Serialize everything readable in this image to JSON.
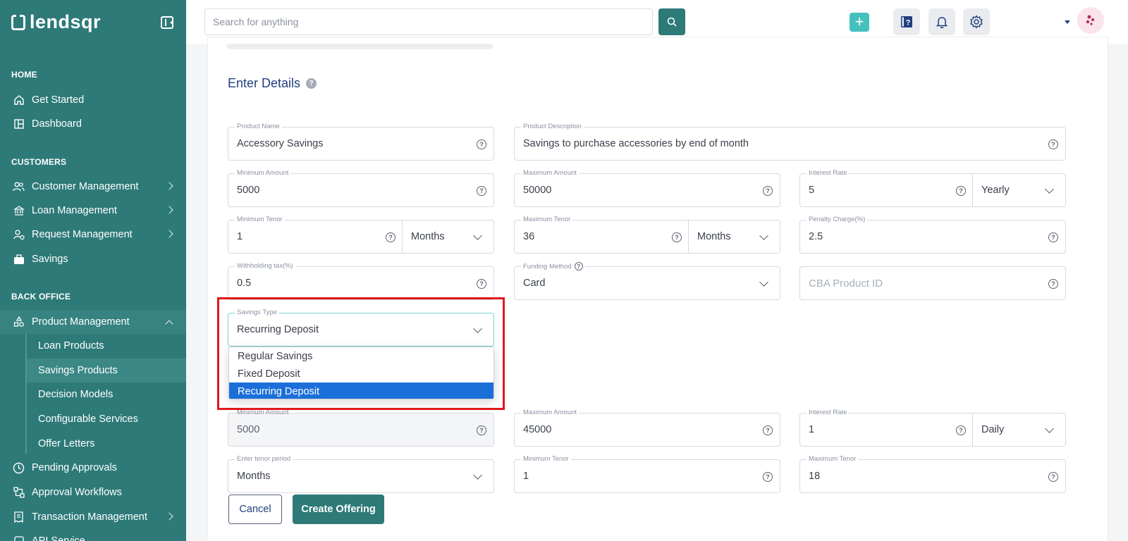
{
  "brand": {
    "name": "lendsqr"
  },
  "search": {
    "placeholder": "Search for anything"
  },
  "sidebar": {
    "sections": [
      "HOME",
      "CUSTOMERS",
      "BACK OFFICE"
    ],
    "items": [
      {
        "label": "Get Started",
        "icon": "home-icon"
      },
      {
        "label": "Dashboard",
        "icon": "dashboard-icon"
      },
      {
        "label": "Customer Management",
        "icon": "users-icon"
      },
      {
        "label": "Loan Management",
        "icon": "bank-icon"
      },
      {
        "label": "Request Management",
        "icon": "request-icon"
      },
      {
        "label": "Savings",
        "icon": "briefcase-icon"
      },
      {
        "label": "Product Management",
        "icon": "shapes-icon"
      },
      {
        "label": "Pending Approvals",
        "icon": "clock-icon"
      },
      {
        "label": "Approval Workflows",
        "icon": "workflow-icon"
      },
      {
        "label": "Transaction Management",
        "icon": "receipt-icon"
      },
      {
        "label": "API Service",
        "icon": "api-icon"
      }
    ],
    "sub_items": [
      "Loan Products",
      "Savings Products",
      "Decision Models",
      "Configurable Services",
      "Offer Letters"
    ]
  },
  "form": {
    "title": "Enter Details",
    "product_name": {
      "label": "Product Name",
      "value": "Accessory Savings"
    },
    "product_description": {
      "label": "Product Description",
      "value": "Savings to purchase accessories by end of month"
    },
    "min_amount": {
      "label": "Minimum Amount",
      "value": "5000"
    },
    "max_amount": {
      "label": "Maximum Amount",
      "value": "50000"
    },
    "interest_rate": {
      "label": "Interest Rate",
      "value": "5",
      "period": "Yearly"
    },
    "min_tenor": {
      "label": "Minimum Tenor",
      "value": "1",
      "unit": "Months"
    },
    "max_tenor": {
      "label": "Maximum Tenor",
      "value": "36",
      "unit": "Months"
    },
    "penalty": {
      "label": "Penalty Charge(%)",
      "value": "2.5"
    },
    "withholding": {
      "label": "Withholding tax(%)",
      "value": "0.5"
    },
    "funding": {
      "label": "Funding Method",
      "value": "Card"
    },
    "cba": {
      "placeholder": "CBA Product ID"
    },
    "savings_type": {
      "label": "Savings Type",
      "value": "Recurring Deposit",
      "options": [
        "Regular Savings",
        "Fixed Deposit",
        "Recurring Deposit"
      ]
    }
  },
  "offering": {
    "min_amount": {
      "label": "Minimum Amount",
      "value": "5000"
    },
    "max_amount": {
      "label": "Maximum Amount",
      "value": "45000"
    },
    "interest_rate": {
      "label": "Interest Rate",
      "value": "1",
      "period": "Daily"
    },
    "tenor_period": {
      "label": "Enter tenor period",
      "value": "Months"
    },
    "min_tenor": {
      "label": "Minimum Tenor",
      "value": "1"
    },
    "max_tenor": {
      "label": "Maximum Tenor",
      "value": "18"
    }
  },
  "buttons": {
    "cancel": "Cancel",
    "create": "Create Offering"
  },
  "colors": {
    "brand": "#2d7a78",
    "accent": "#44c1bd",
    "highlight": "#e0181c",
    "selected": "#1b6fd8"
  }
}
